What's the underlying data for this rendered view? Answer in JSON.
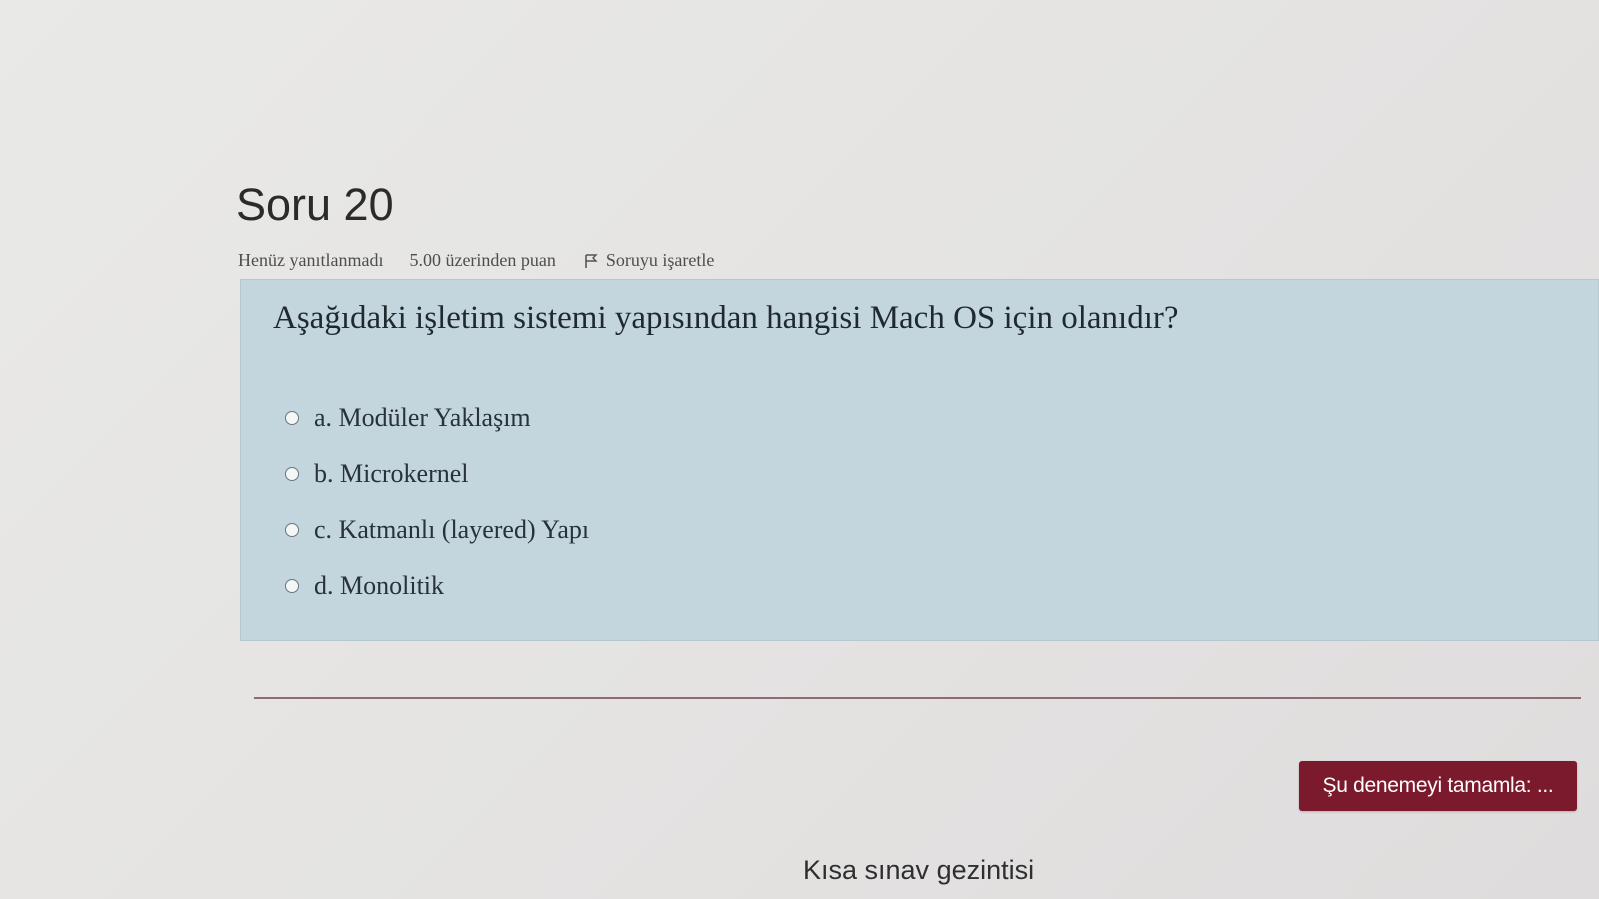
{
  "question": {
    "title": "Soru 20",
    "status": "Henüz yanıtlanmadı",
    "grade": "5.00 üzerinden puan",
    "flag_label": "Soruyu işaretle",
    "text": "Aşağıdaki işletim sistemi yapısından hangisi Mach OS için olanıdır?",
    "answers": [
      {
        "label": "a. Modüler Yaklaşım"
      },
      {
        "label": "b. Microkernel"
      },
      {
        "label": "c. Katmanlı (layered) Yapı"
      },
      {
        "label": "d. Monolitik"
      }
    ]
  },
  "actions": {
    "finish_label": "Şu denemeyi tamamla: ..."
  },
  "navigation": {
    "title": "Kısa sınav gezintisi"
  },
  "icons": {
    "flag": "flag-icon"
  },
  "colors": {
    "question_bg": "#c4d6dd",
    "finish_button": "#7b1a2c"
  }
}
